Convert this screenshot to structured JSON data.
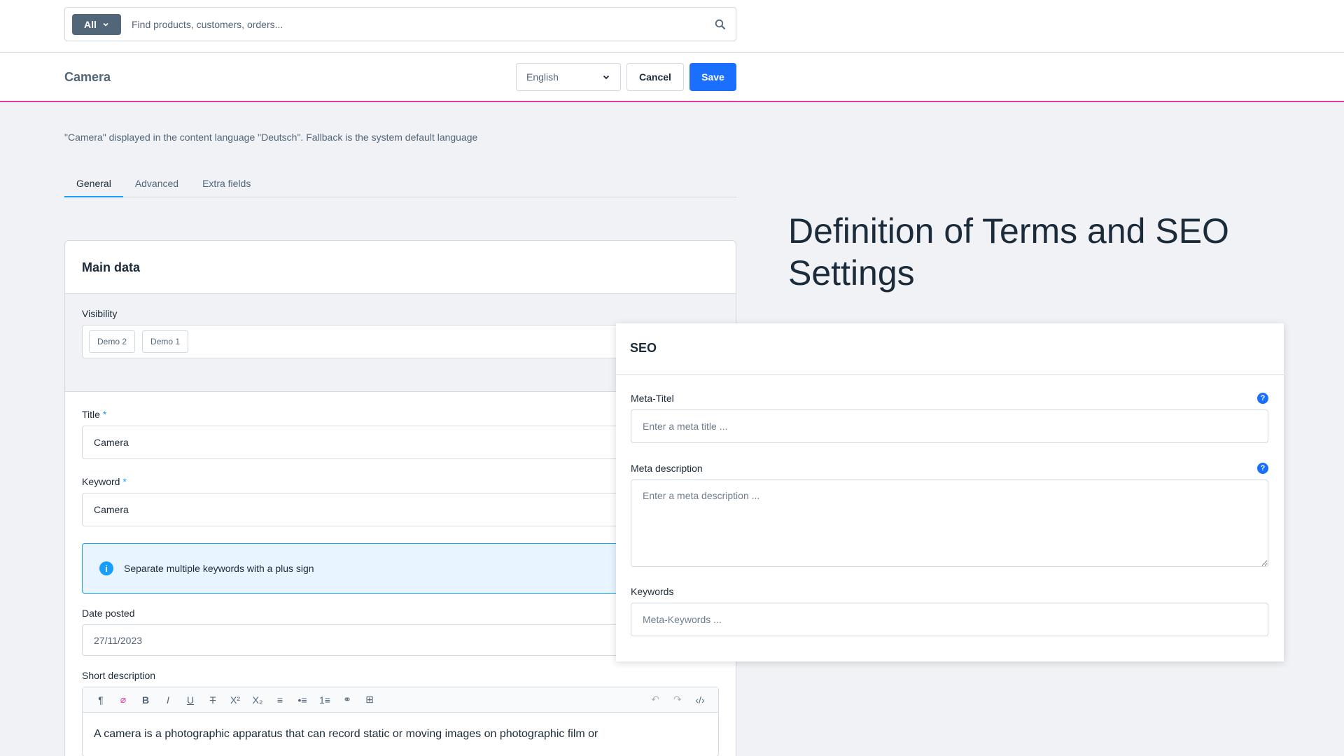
{
  "search": {
    "scope_label": "All",
    "placeholder": "Find products, customers, orders..."
  },
  "header": {
    "title": "Camera",
    "language": "English",
    "cancel_label": "Cancel",
    "save_label": "Save"
  },
  "notice": "\"Camera\" displayed in the content language \"Deutsch\". Fallback is the system default language",
  "tabs": [
    "General",
    "Advanced",
    "Extra fields"
  ],
  "main_card": {
    "title": "Main data",
    "visibility_label": "Visibility",
    "visibility_chips": [
      "Demo 2",
      "Demo 1"
    ],
    "title_label": "Title",
    "title_value": "Camera",
    "keyword_label": "Keyword",
    "keyword_value": "Camera",
    "keyword_hint": "Separate multiple keywords with a plus sign",
    "date_label": "Date posted",
    "date_value": "27/11/2023",
    "short_desc_label": "Short description",
    "short_desc_text": "A camera is a photographic apparatus that can record static or moving images on photographic film or",
    "required_mark": "*"
  },
  "heading": "Definition of Terms and SEO Settings",
  "seo": {
    "title": "SEO",
    "meta_title_label": "Meta-Titel",
    "meta_title_placeholder": "Enter a meta title ...",
    "meta_desc_label": "Meta description",
    "meta_desc_placeholder": "Enter a meta description ...",
    "keywords_label": "Keywords",
    "keywords_placeholder": "Meta-Keywords ...",
    "help_glyph": "?"
  },
  "colors": {
    "primary": "#1a6fff",
    "accent_line": "#e3399b",
    "tab_active": "#189eff"
  }
}
